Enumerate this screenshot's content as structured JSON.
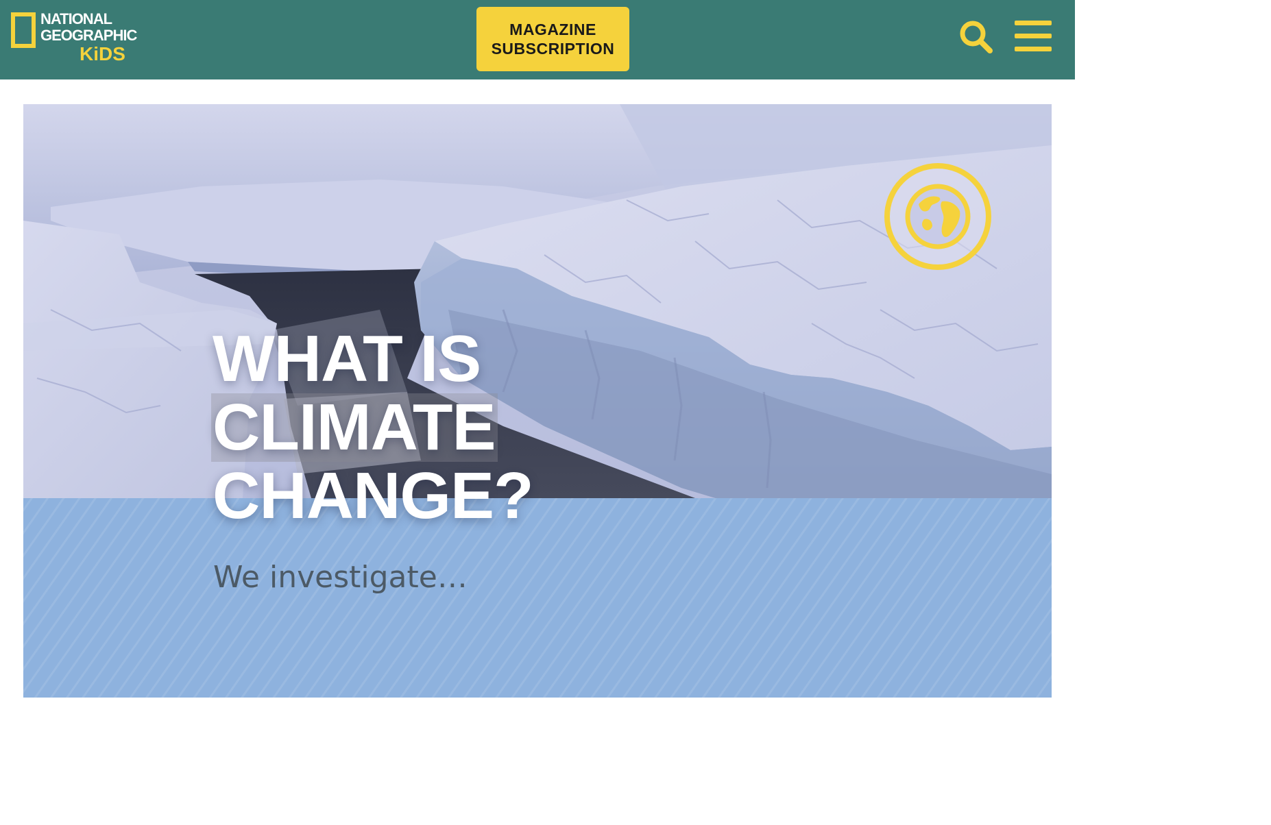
{
  "header": {
    "logo": {
      "line1": "NATIONAL",
      "line2": "GEOGRAPHIC",
      "line3": "KiDS"
    },
    "subscribe_label": "MAGAZINE\nSUBSCRIPTION",
    "search_icon": "search-icon",
    "menu_icon": "hamburger-menu-icon"
  },
  "hero": {
    "title_lines": [
      "WHAT IS",
      "CLIMATE",
      "CHANGE?"
    ],
    "subtitle": "We investigate…",
    "badge_icon": "globe-icon"
  },
  "colors": {
    "header_bg": "#3a7b74",
    "accent_yellow": "#f5d23c",
    "band_blue": "#8eb2de",
    "subtitle_gray": "#4c5a66"
  }
}
